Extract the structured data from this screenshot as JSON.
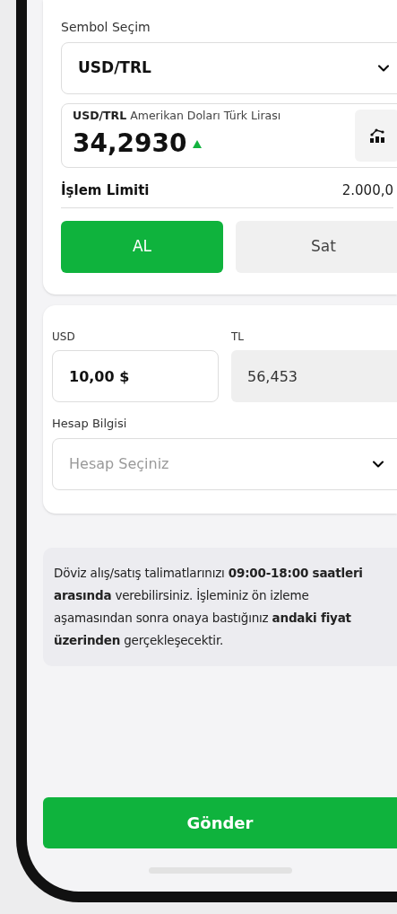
{
  "symbol_select": {
    "label": "Sembol Seçim",
    "value": "USD/TRL"
  },
  "quote": {
    "code": "USD/TRL",
    "name": "Amerikan Doları Türk Lirası",
    "price": "34,2930",
    "rising": true
  },
  "limit": {
    "label": "İşlem Limiti",
    "value": "2.000,0"
  },
  "sides": [
    {
      "label": "AL",
      "selected": true
    },
    {
      "label": "Sat",
      "selected": false
    }
  ],
  "amount": {
    "usd_label": "USD",
    "usd_value": "10,00 $",
    "tl_label": "TL",
    "tl_value": "56,453"
  },
  "account": {
    "label": "Hesap Bilgisi",
    "placeholder": "Hesap Seçiniz"
  },
  "note": "Döviz alış/satış talimatlarınızı **09:00-18:00 saatleri arasında** verebilirsiniz. İşleminiz ön izleme aşamasından sonra onaya bastığınız **andaki fiyat üzerinden** gerçekleşecektir.",
  "submit": "Gönder"
}
